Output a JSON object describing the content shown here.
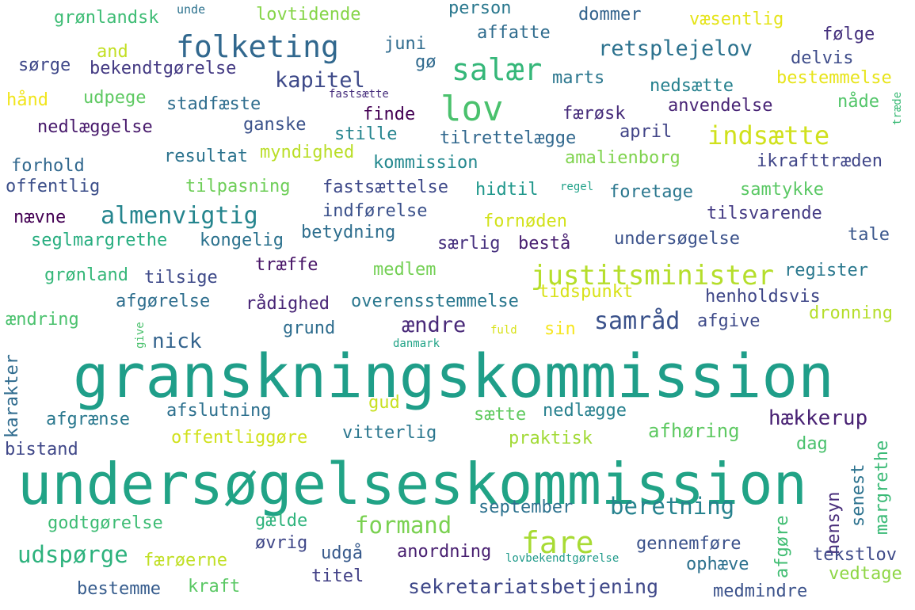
{
  "words": [
    {
      "text": "granskningskommission",
      "color": "#1f9e89"
    },
    {
      "text": "undersøgelseskommission",
      "color": "#21a386"
    },
    {
      "text": "folketing",
      "color": "#31688e"
    },
    {
      "text": "lov",
      "color": "#4ac16d"
    },
    {
      "text": "salær",
      "color": "#35b779"
    },
    {
      "text": "justitsminister",
      "color": "#b5de2b"
    },
    {
      "text": "almenvigtig",
      "color": "#25858e"
    },
    {
      "text": "fare",
      "color": "#a8db34"
    },
    {
      "text": "indsætte",
      "color": "#d0e11c"
    },
    {
      "text": "samråd",
      "color": "#3b528b"
    },
    {
      "text": "formand",
      "color": "#7ad151"
    },
    {
      "text": "beretning",
      "color": "#26828e"
    },
    {
      "text": "udspørge",
      "color": "#2db27d"
    },
    {
      "text": "kapitel",
      "color": "#3e4a89"
    },
    {
      "text": "retsplejelov",
      "color": "#2c728e"
    },
    {
      "text": "ændre",
      "color": "#482878"
    },
    {
      "text": "grønlandsk",
      "color": "#3dbc74"
    },
    {
      "text": "lovtidende",
      "color": "#86d549"
    },
    {
      "text": "person",
      "color": "#2a788e"
    },
    {
      "text": "unde",
      "color": "#2c728e"
    },
    {
      "text": "dommer",
      "color": "#33638d"
    },
    {
      "text": "væsentlig",
      "color": "#e5e419"
    },
    {
      "text": "affatte",
      "color": "#2f6c8e"
    },
    {
      "text": "følge",
      "color": "#46327e"
    },
    {
      "text": "and",
      "color": "#c2df23"
    },
    {
      "text": "juni",
      "color": "#2f6b8e"
    },
    {
      "text": "delvis",
      "color": "#3e4c8a"
    },
    {
      "text": "sørge",
      "color": "#3f4889"
    },
    {
      "text": "bekendtgørelse",
      "color": "#443a83"
    },
    {
      "text": "gø",
      "color": "#306a8e"
    },
    {
      "text": "marts",
      "color": "#2a768e"
    },
    {
      "text": "bestemmelse",
      "color": "#e7e419"
    },
    {
      "text": "hånd",
      "color": "#f1e51d"
    },
    {
      "text": "udpege",
      "color": "#5ec962"
    },
    {
      "text": "fastsætte",
      "color": "#472f7d"
    },
    {
      "text": "nedsætte",
      "color": "#26818e"
    },
    {
      "text": "stadfæste",
      "color": "#2e6d8e"
    },
    {
      "text": "nåde",
      "color": "#52c569"
    },
    {
      "text": "anvendelse",
      "color": "#482475"
    },
    {
      "text": "træde",
      "color": "#3aba76"
    },
    {
      "text": "finde",
      "color": "#440154"
    },
    {
      "text": "færøsk",
      "color": "#472d7b"
    },
    {
      "text": "nedlæggelse",
      "color": "#481a6c"
    },
    {
      "text": "ganske",
      "color": "#3b528b"
    },
    {
      "text": "stille",
      "color": "#25848e"
    },
    {
      "text": "april",
      "color": "#414487"
    },
    {
      "text": "tilrettelægge",
      "color": "#31688e"
    },
    {
      "text": "resultat",
      "color": "#2c738e"
    },
    {
      "text": "myndighed",
      "color": "#bade28"
    },
    {
      "text": "amalienborg",
      "color": "#7fd34e"
    },
    {
      "text": "ikrafttræden",
      "color": "#404688"
    },
    {
      "text": "forhold",
      "color": "#31688e"
    },
    {
      "text": "kommission",
      "color": "#23888e"
    },
    {
      "text": "offentlig",
      "color": "#3c4f8a"
    },
    {
      "text": "tilpasning",
      "color": "#6ece58"
    },
    {
      "text": "fastsættelse",
      "color": "#3e4989"
    },
    {
      "text": "hidtil",
      "color": "#1f978b"
    },
    {
      "text": "regel",
      "color": "#1fa188"
    },
    {
      "text": "foretage",
      "color": "#2a778e"
    },
    {
      "text": "samtykke",
      "color": "#5ac864"
    },
    {
      "text": "nævne",
      "color": "#440154"
    },
    {
      "text": "indførelse",
      "color": "#3b518b"
    },
    {
      "text": "tilsvarende",
      "color": "#443b84"
    },
    {
      "text": "fornøden",
      "color": "#d2e21b"
    },
    {
      "text": "seglmargrethe",
      "color": "#28ae80"
    },
    {
      "text": "kongelig",
      "color": "#2c728e"
    },
    {
      "text": "betydning",
      "color": "#2e6e8e"
    },
    {
      "text": "tale",
      "color": "#39568c"
    },
    {
      "text": "særlig",
      "color": "#46307e"
    },
    {
      "text": "bestå",
      "color": "#481f70"
    },
    {
      "text": "undersøgelse",
      "color": "#3b528b"
    },
    {
      "text": "træffe",
      "color": "#481467"
    },
    {
      "text": "medlem",
      "color": "#74d055"
    },
    {
      "text": "register",
      "color": "#2a788e"
    },
    {
      "text": "grønland",
      "color": "#35b779"
    },
    {
      "text": "tilsige",
      "color": "#3e4a89"
    },
    {
      "text": "afgørelse",
      "color": "#2e6e8e"
    },
    {
      "text": "tidspunkt",
      "color": "#d8e219"
    },
    {
      "text": "rådighed",
      "color": "#482576"
    },
    {
      "text": "overensstemmelse",
      "color": "#2a778e"
    },
    {
      "text": "henholdsvis",
      "color": "#3f4788"
    },
    {
      "text": "ændring",
      "color": "#4ac16d"
    },
    {
      "text": "dronning",
      "color": "#b5de2b"
    },
    {
      "text": "afgive",
      "color": "#3e4a89"
    },
    {
      "text": "grund",
      "color": "#2e6d8e"
    },
    {
      "text": "sin",
      "color": "#f6e620"
    },
    {
      "text": "nick",
      "color": "#33638d"
    },
    {
      "text": "give",
      "color": "#4ac16d"
    },
    {
      "text": "fuld",
      "color": "#d8e219"
    },
    {
      "text": "danmark",
      "color": "#20a386"
    },
    {
      "text": "karakter",
      "color": "#2f6b8e"
    },
    {
      "text": "gud",
      "color": "#c8e020"
    },
    {
      "text": "afgrænse",
      "color": "#2a788e"
    },
    {
      "text": "afslutning",
      "color": "#2d708e"
    },
    {
      "text": "sætte",
      "color": "#60ca60"
    },
    {
      "text": "nedlægge",
      "color": "#27808e"
    },
    {
      "text": "hækkerup",
      "color": "#482173"
    },
    {
      "text": "offentliggøre",
      "color": "#d0e11c"
    },
    {
      "text": "afhøring",
      "color": "#5ec962"
    },
    {
      "text": "bistand",
      "color": "#3f4788"
    },
    {
      "text": "vitterlig",
      "color": "#2a768e"
    },
    {
      "text": "praktisk",
      "color": "#a2da37"
    },
    {
      "text": "dag",
      "color": "#4ac16d"
    },
    {
      "text": "margrethe",
      "color": "#3aba76"
    },
    {
      "text": "senest",
      "color": "#2c728e"
    },
    {
      "text": "hensyn",
      "color": "#472c7a"
    },
    {
      "text": "afgøre",
      "color": "#40bd72"
    },
    {
      "text": "september",
      "color": "#2c718e"
    },
    {
      "text": "godtgørelse",
      "color": "#3dbc74"
    },
    {
      "text": "gælde",
      "color": "#2eb37c"
    },
    {
      "text": "øvrig",
      "color": "#3f4788"
    },
    {
      "text": "gennemføre",
      "color": "#3b528b"
    },
    {
      "text": "udgå",
      "color": "#375a8c"
    },
    {
      "text": "anordning",
      "color": "#481f70"
    },
    {
      "text": "lovbekendtgørelse",
      "color": "#1f9a8a"
    },
    {
      "text": "ophæve",
      "color": "#2d718e"
    },
    {
      "text": "tekstlov",
      "color": "#3e4a89"
    },
    {
      "text": "færøerne",
      "color": "#c0df25"
    },
    {
      "text": "titel",
      "color": "#424086"
    },
    {
      "text": "vedtage",
      "color": "#8ed645"
    },
    {
      "text": "sekretariatsbetjening",
      "color": "#3f4889"
    },
    {
      "text": "bestemme",
      "color": "#365c8d"
    },
    {
      "text": "kraft",
      "color": "#5ac864"
    },
    {
      "text": "medmindre",
      "color": "#3b528b"
    }
  ]
}
